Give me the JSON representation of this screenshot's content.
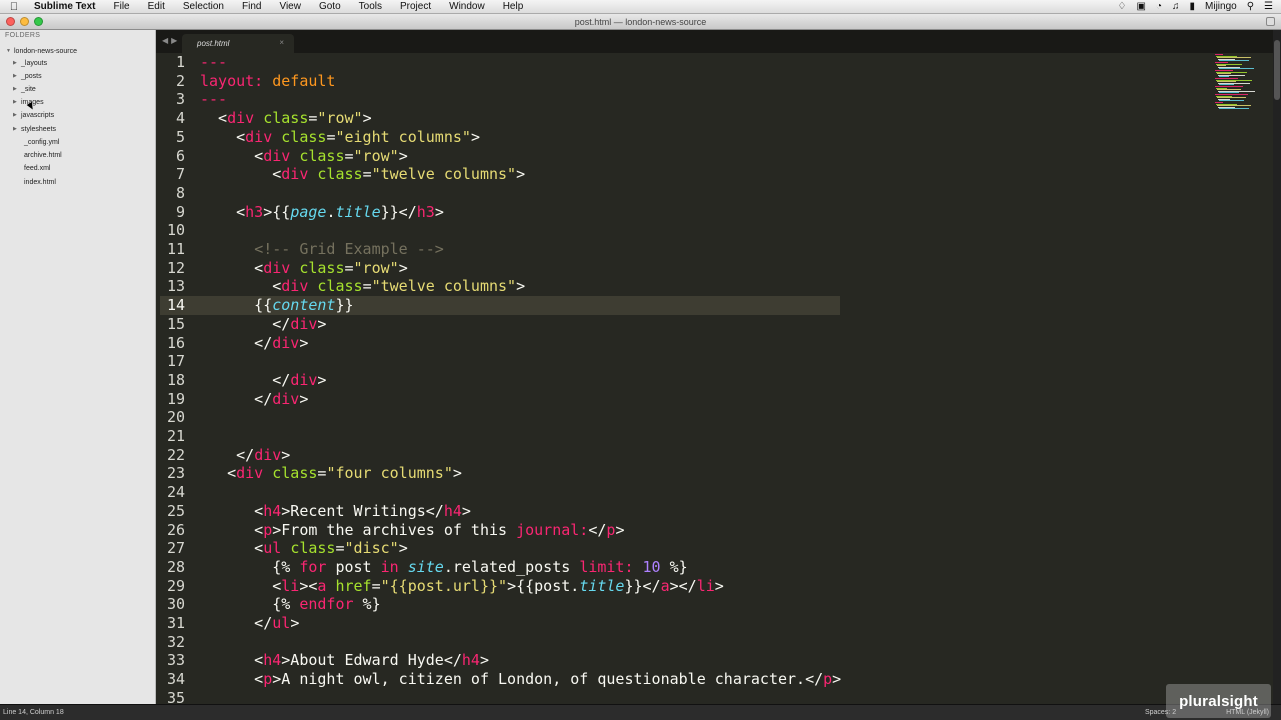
{
  "menubar": {
    "app_name": "Sublime Text",
    "items": [
      "File",
      "Edit",
      "Selection",
      "Find",
      "View",
      "Goto",
      "Tools",
      "Project",
      "Window",
      "Help"
    ],
    "user": "Mijingo"
  },
  "window": {
    "title": "post.html — london-news-source"
  },
  "sidebar": {
    "header": "FOLDERS",
    "root": "london-news-source",
    "folders": [
      "_layouts",
      "_posts",
      "_site",
      "images",
      "javascripts",
      "stylesheets"
    ],
    "files": [
      "_config.yml",
      "archive.html",
      "feed.xml",
      "index.html"
    ]
  },
  "tab": {
    "label": "post.html",
    "close": "×"
  },
  "editor": {
    "current_line": 14,
    "line_numbers": [
      "1",
      "2",
      "3",
      "4",
      "5",
      "6",
      "7",
      "8",
      "9",
      "10",
      "11",
      "12",
      "13",
      "14",
      "15",
      "16",
      "17",
      "18",
      "19",
      "20",
      "21",
      "22",
      "23",
      "24",
      "25",
      "26",
      "27",
      "28",
      "29",
      "30",
      "31",
      "32",
      "33",
      "34",
      "35"
    ]
  },
  "status": {
    "position": "Line 14, Column 18",
    "spaces": "Spaces: 2",
    "syntax": "HTML (Jekyll)"
  },
  "watermark": "pluralsight",
  "colors": {
    "background": "#272822",
    "tag": "#f92672",
    "attribute": "#a6e22e",
    "string": "#e6db74",
    "comment": "#75715e",
    "variable": "#66d9ef",
    "number": "#ae81ff"
  }
}
